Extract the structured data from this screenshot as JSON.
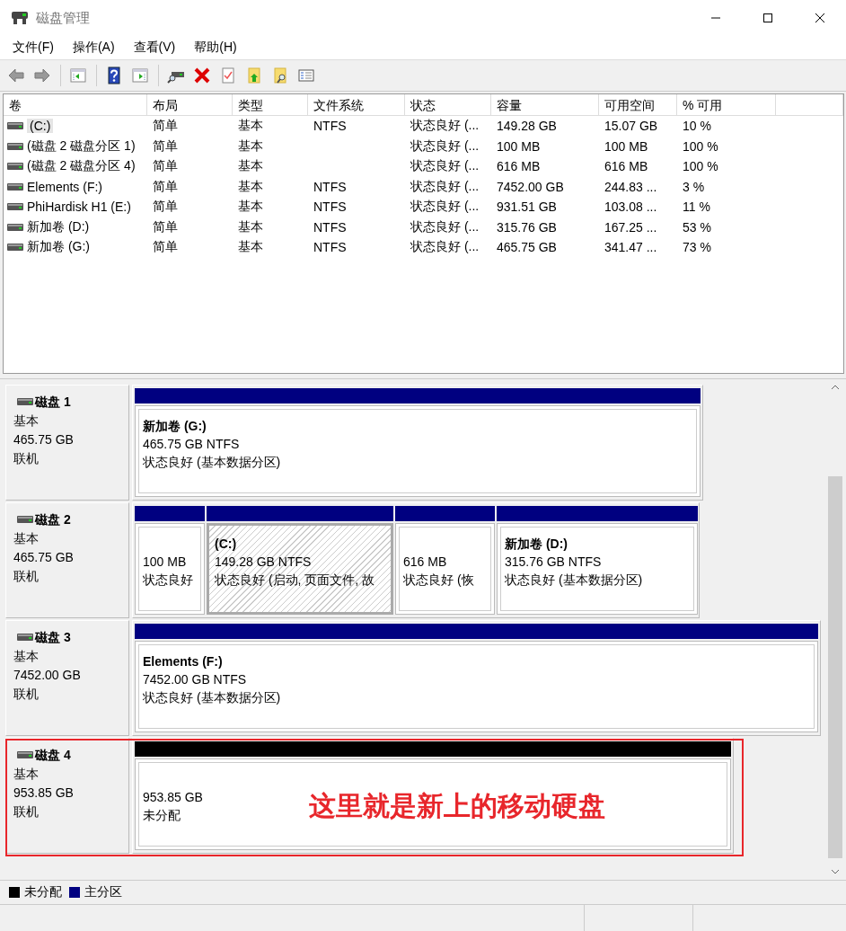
{
  "window": {
    "title": "磁盘管理"
  },
  "menu": [
    "文件(F)",
    "操作(A)",
    "查看(V)",
    "帮助(H)"
  ],
  "volume_table": {
    "columns": [
      "卷",
      "布局",
      "类型",
      "文件系统",
      "状态",
      "容量",
      "可用空间",
      "% 可用"
    ],
    "rows": [
      {
        "selected": true,
        "cells": [
          "(C:)",
          "简单",
          "基本",
          "NTFS",
          "状态良好 (...",
          "149.28 GB",
          "15.07 GB",
          "10 %"
        ]
      },
      {
        "selected": false,
        "cells": [
          "(磁盘 2 磁盘分区 1)",
          "简单",
          "基本",
          "",
          "状态良好 (...",
          "100 MB",
          "100 MB",
          "100 %"
        ]
      },
      {
        "selected": false,
        "cells": [
          "(磁盘 2 磁盘分区 4)",
          "简单",
          "基本",
          "",
          "状态良好 (...",
          "616 MB",
          "616 MB",
          "100 %"
        ]
      },
      {
        "selected": false,
        "cells": [
          "Elements (F:)",
          "简单",
          "基本",
          "NTFS",
          "状态良好 (...",
          "7452.00 GB",
          "244.83 ...",
          "3 %"
        ]
      },
      {
        "selected": false,
        "cells": [
          "PhiHardisk H1 (E:)",
          "简单",
          "基本",
          "NTFS",
          "状态良好 (...",
          "931.51 GB",
          "103.08 ...",
          "11 %"
        ]
      },
      {
        "selected": false,
        "cells": [
          "新加卷 (D:)",
          "简单",
          "基本",
          "NTFS",
          "状态良好 (...",
          "315.76 GB",
          "167.25 ...",
          "53 %"
        ]
      },
      {
        "selected": false,
        "cells": [
          "新加卷 (G:)",
          "简单",
          "基本",
          "NTFS",
          "状态良好 (...",
          "465.75 GB",
          "341.47 ...",
          "73 %"
        ]
      }
    ]
  },
  "disks": [
    {
      "name": "磁盘 1",
      "type": "基本",
      "size": "465.75 GB",
      "status": "联机",
      "partitions": [
        {
          "kind": "primary",
          "selected": false,
          "label": "新加卷 (G:)",
          "size": "465.75 GB NTFS",
          "status": "状态良好 (基本数据分区)"
        }
      ]
    },
    {
      "name": "磁盘 2",
      "type": "基本",
      "size": "465.75 GB",
      "status": "联机",
      "partitions": [
        {
          "kind": "primary",
          "selected": false,
          "size": "100 MB",
          "status": "状态良好"
        },
        {
          "kind": "primary",
          "selected": true,
          "label": "(C:)",
          "size": "149.28 GB NTFS",
          "status": "状态良好 (启动, 页面文件, 故"
        },
        {
          "kind": "primary",
          "selected": false,
          "size": "616 MB",
          "status": "状态良好 (恢"
        },
        {
          "kind": "primary",
          "selected": false,
          "label": "新加卷 (D:)",
          "size": "315.76 GB NTFS",
          "status": "状态良好 (基本数据分区)"
        }
      ]
    },
    {
      "name": "磁盘 3",
      "type": "基本",
      "size": "7452.00 GB",
      "status": "联机",
      "partitions": [
        {
          "kind": "primary",
          "selected": false,
          "label": "Elements (F:)",
          "size": "7452.00 GB NTFS",
          "status": "状态良好 (基本数据分区)"
        }
      ]
    },
    {
      "name": "磁盘 4",
      "type": "基本",
      "size": "953.85 GB",
      "status": "联机",
      "partitions": [
        {
          "kind": "unallocated",
          "selected": false,
          "size": "953.85 GB",
          "status": "未分配"
        }
      ]
    }
  ],
  "annotation": {
    "text": "这里就是新上的移动硬盘"
  },
  "legend": [
    {
      "label": "未分配",
      "color": "#000000"
    },
    {
      "label": "主分区",
      "color": "#000080"
    }
  ]
}
